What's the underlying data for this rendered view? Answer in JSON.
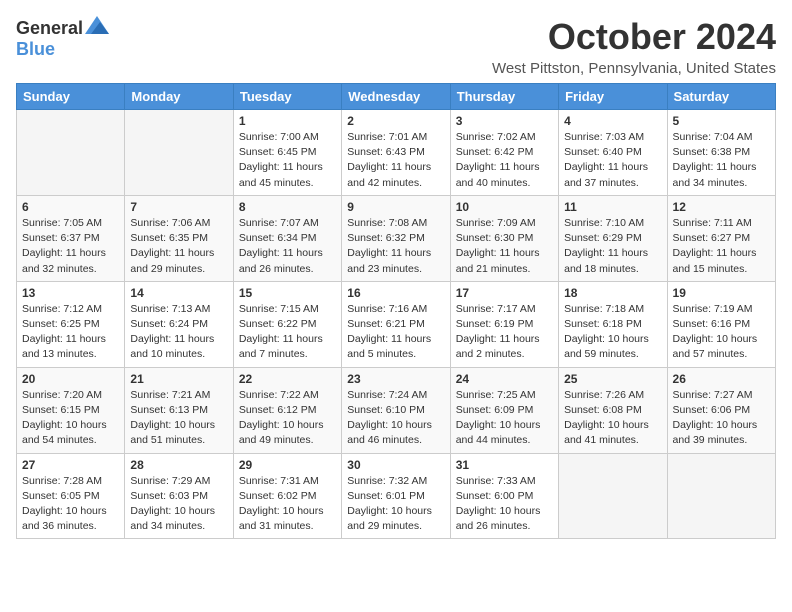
{
  "logo": {
    "general": "General",
    "blue": "Blue"
  },
  "title": "October 2024",
  "location": "West Pittston, Pennsylvania, United States",
  "weekdays": [
    "Sunday",
    "Monday",
    "Tuesday",
    "Wednesday",
    "Thursday",
    "Friday",
    "Saturday"
  ],
  "weeks": [
    [
      {
        "day": "",
        "info": ""
      },
      {
        "day": "",
        "info": ""
      },
      {
        "day": "1",
        "info": "Sunrise: 7:00 AM\nSunset: 6:45 PM\nDaylight: 11 hours and 45 minutes."
      },
      {
        "day": "2",
        "info": "Sunrise: 7:01 AM\nSunset: 6:43 PM\nDaylight: 11 hours and 42 minutes."
      },
      {
        "day": "3",
        "info": "Sunrise: 7:02 AM\nSunset: 6:42 PM\nDaylight: 11 hours and 40 minutes."
      },
      {
        "day": "4",
        "info": "Sunrise: 7:03 AM\nSunset: 6:40 PM\nDaylight: 11 hours and 37 minutes."
      },
      {
        "day": "5",
        "info": "Sunrise: 7:04 AM\nSunset: 6:38 PM\nDaylight: 11 hours and 34 minutes."
      }
    ],
    [
      {
        "day": "6",
        "info": "Sunrise: 7:05 AM\nSunset: 6:37 PM\nDaylight: 11 hours and 32 minutes."
      },
      {
        "day": "7",
        "info": "Sunrise: 7:06 AM\nSunset: 6:35 PM\nDaylight: 11 hours and 29 minutes."
      },
      {
        "day": "8",
        "info": "Sunrise: 7:07 AM\nSunset: 6:34 PM\nDaylight: 11 hours and 26 minutes."
      },
      {
        "day": "9",
        "info": "Sunrise: 7:08 AM\nSunset: 6:32 PM\nDaylight: 11 hours and 23 minutes."
      },
      {
        "day": "10",
        "info": "Sunrise: 7:09 AM\nSunset: 6:30 PM\nDaylight: 11 hours and 21 minutes."
      },
      {
        "day": "11",
        "info": "Sunrise: 7:10 AM\nSunset: 6:29 PM\nDaylight: 11 hours and 18 minutes."
      },
      {
        "day": "12",
        "info": "Sunrise: 7:11 AM\nSunset: 6:27 PM\nDaylight: 11 hours and 15 minutes."
      }
    ],
    [
      {
        "day": "13",
        "info": "Sunrise: 7:12 AM\nSunset: 6:25 PM\nDaylight: 11 hours and 13 minutes."
      },
      {
        "day": "14",
        "info": "Sunrise: 7:13 AM\nSunset: 6:24 PM\nDaylight: 11 hours and 10 minutes."
      },
      {
        "day": "15",
        "info": "Sunrise: 7:15 AM\nSunset: 6:22 PM\nDaylight: 11 hours and 7 minutes."
      },
      {
        "day": "16",
        "info": "Sunrise: 7:16 AM\nSunset: 6:21 PM\nDaylight: 11 hours and 5 minutes."
      },
      {
        "day": "17",
        "info": "Sunrise: 7:17 AM\nSunset: 6:19 PM\nDaylight: 11 hours and 2 minutes."
      },
      {
        "day": "18",
        "info": "Sunrise: 7:18 AM\nSunset: 6:18 PM\nDaylight: 10 hours and 59 minutes."
      },
      {
        "day": "19",
        "info": "Sunrise: 7:19 AM\nSunset: 6:16 PM\nDaylight: 10 hours and 57 minutes."
      }
    ],
    [
      {
        "day": "20",
        "info": "Sunrise: 7:20 AM\nSunset: 6:15 PM\nDaylight: 10 hours and 54 minutes."
      },
      {
        "day": "21",
        "info": "Sunrise: 7:21 AM\nSunset: 6:13 PM\nDaylight: 10 hours and 51 minutes."
      },
      {
        "day": "22",
        "info": "Sunrise: 7:22 AM\nSunset: 6:12 PM\nDaylight: 10 hours and 49 minutes."
      },
      {
        "day": "23",
        "info": "Sunrise: 7:24 AM\nSunset: 6:10 PM\nDaylight: 10 hours and 46 minutes."
      },
      {
        "day": "24",
        "info": "Sunrise: 7:25 AM\nSunset: 6:09 PM\nDaylight: 10 hours and 44 minutes."
      },
      {
        "day": "25",
        "info": "Sunrise: 7:26 AM\nSunset: 6:08 PM\nDaylight: 10 hours and 41 minutes."
      },
      {
        "day": "26",
        "info": "Sunrise: 7:27 AM\nSunset: 6:06 PM\nDaylight: 10 hours and 39 minutes."
      }
    ],
    [
      {
        "day": "27",
        "info": "Sunrise: 7:28 AM\nSunset: 6:05 PM\nDaylight: 10 hours and 36 minutes."
      },
      {
        "day": "28",
        "info": "Sunrise: 7:29 AM\nSunset: 6:03 PM\nDaylight: 10 hours and 34 minutes."
      },
      {
        "day": "29",
        "info": "Sunrise: 7:31 AM\nSunset: 6:02 PM\nDaylight: 10 hours and 31 minutes."
      },
      {
        "day": "30",
        "info": "Sunrise: 7:32 AM\nSunset: 6:01 PM\nDaylight: 10 hours and 29 minutes."
      },
      {
        "day": "31",
        "info": "Sunrise: 7:33 AM\nSunset: 6:00 PM\nDaylight: 10 hours and 26 minutes."
      },
      {
        "day": "",
        "info": ""
      },
      {
        "day": "",
        "info": ""
      }
    ]
  ]
}
